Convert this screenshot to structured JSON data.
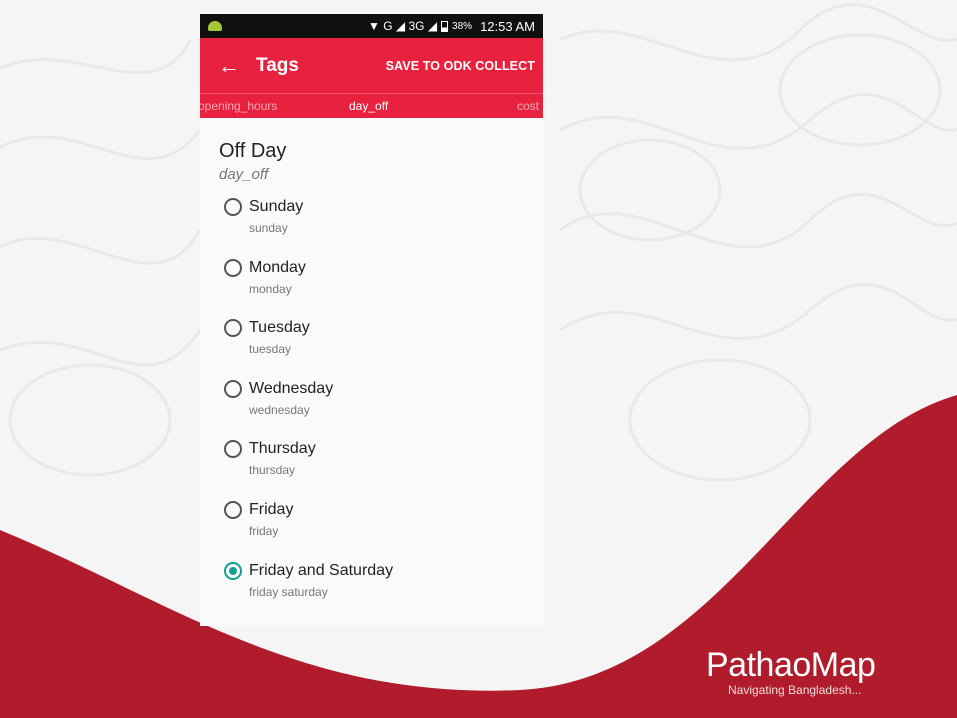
{
  "status_bar": {
    "signal_text": "▼ G ◢ 3G ◢",
    "battery": "38%",
    "time": "12:53 AM"
  },
  "app_bar": {
    "back_icon": "arrow-left-icon",
    "title": "Tags",
    "save_label": "SAVE TO ODK COLLECT"
  },
  "tabs": [
    {
      "label": "opening_hours",
      "selected": false
    },
    {
      "label": "day_off",
      "selected": true
    },
    {
      "label": "cost",
      "selected": false
    }
  ],
  "question": {
    "title": "Off Day",
    "key": "day_off",
    "options": [
      {
        "label": "Sunday",
        "value": "sunday",
        "checked": false
      },
      {
        "label": "Monday",
        "value": "monday",
        "checked": false
      },
      {
        "label": "Tuesday",
        "value": "tuesday",
        "checked": false
      },
      {
        "label": "Wednesday",
        "value": "wednesday",
        "checked": false
      },
      {
        "label": "Thursday",
        "value": "thursday",
        "checked": false
      },
      {
        "label": "Friday",
        "value": "friday",
        "checked": false
      },
      {
        "label": "Friday and Saturday",
        "value": "friday saturday",
        "checked": true
      }
    ]
  },
  "branding": {
    "name": "PathaoMap",
    "tagline": "Navigating Bangladesh..."
  },
  "colors": {
    "accent": "#e8213f",
    "wave": "#b01c2b",
    "radio_checked": "#159e94"
  }
}
